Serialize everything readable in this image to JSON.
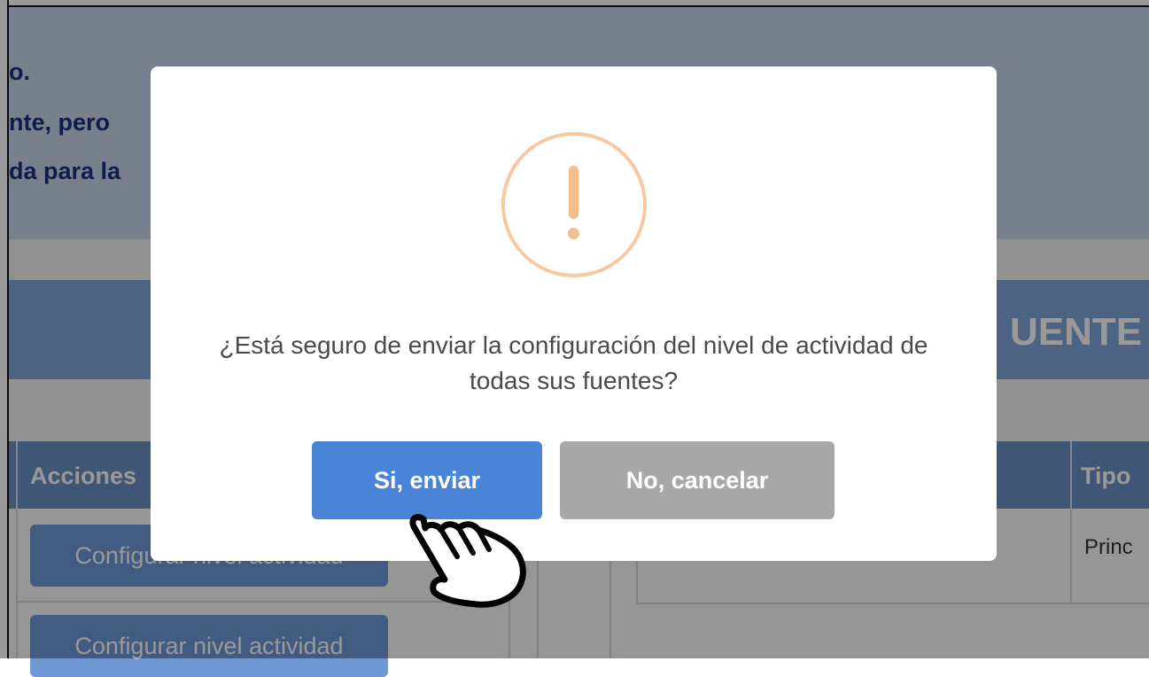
{
  "background": {
    "notice_lines": [
      "o.",
      "nte, pero",
      "da para la"
    ],
    "section_title": "UENTE",
    "table_headers": [
      "Acciones",
      "Tipo"
    ],
    "table_cell": "Princ",
    "row_buttons": [
      "Configurar nivel actividad",
      "Configurar nivel actividad"
    ]
  },
  "dialog": {
    "icon": "exclamation-warning-icon",
    "message": "¿Está seguro de enviar la configuración del nivel de actividad de todas sus fuentes?",
    "confirm_label": "Si, enviar",
    "cancel_label": "No, cancelar"
  },
  "cursor": {
    "icon": "hand-pointer-icon"
  },
  "colors": {
    "accent": "#4a84d6",
    "cancel": "#a8a8a8",
    "warning": "#f3be8b",
    "notice_text": "#14337a"
  }
}
